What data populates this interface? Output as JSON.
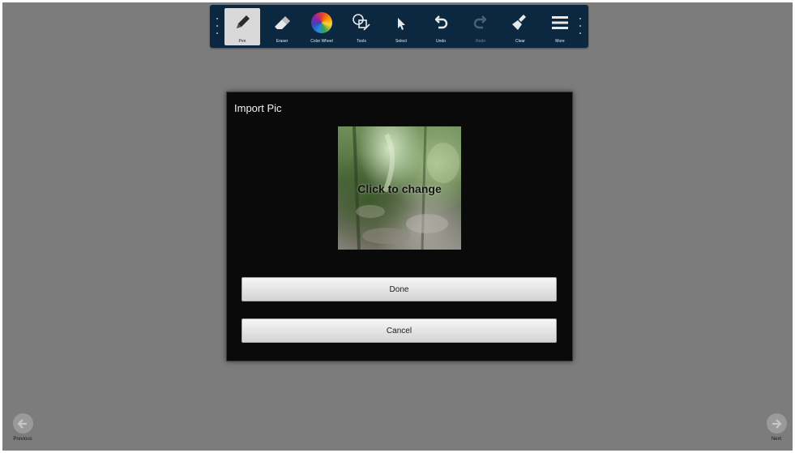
{
  "colors": {
    "toolbar_bg": "#0c2840",
    "canvas_bg": "#7c7c7c",
    "dialog_bg": "#0a0a0a"
  },
  "toolbar": {
    "tools": [
      {
        "id": "pen",
        "label": "Pen",
        "icon": "pen-icon",
        "active": true
      },
      {
        "id": "eraser",
        "label": "Eraser",
        "icon": "eraser-icon"
      },
      {
        "id": "color-wheel",
        "label": "Color Wheel",
        "icon": "color-wheel-icon"
      },
      {
        "id": "tools",
        "label": "Tools",
        "icon": "shapes-icon"
      },
      {
        "id": "select",
        "label": "Select",
        "icon": "cursor-icon"
      },
      {
        "id": "undo",
        "label": "Undo",
        "icon": "undo-icon"
      },
      {
        "id": "redo",
        "label": "Redo",
        "icon": "redo-icon",
        "disabled": true
      },
      {
        "id": "clear",
        "label": "Clear",
        "icon": "broom-icon"
      },
      {
        "id": "more",
        "label": "More",
        "icon": "menu-icon"
      }
    ]
  },
  "dialog": {
    "title": "Import Pic",
    "picture_caption": "Click to change",
    "done_label": "Done",
    "cancel_label": "Cancel"
  },
  "nav": {
    "previous_label": "Previous",
    "next_label": "Next"
  }
}
